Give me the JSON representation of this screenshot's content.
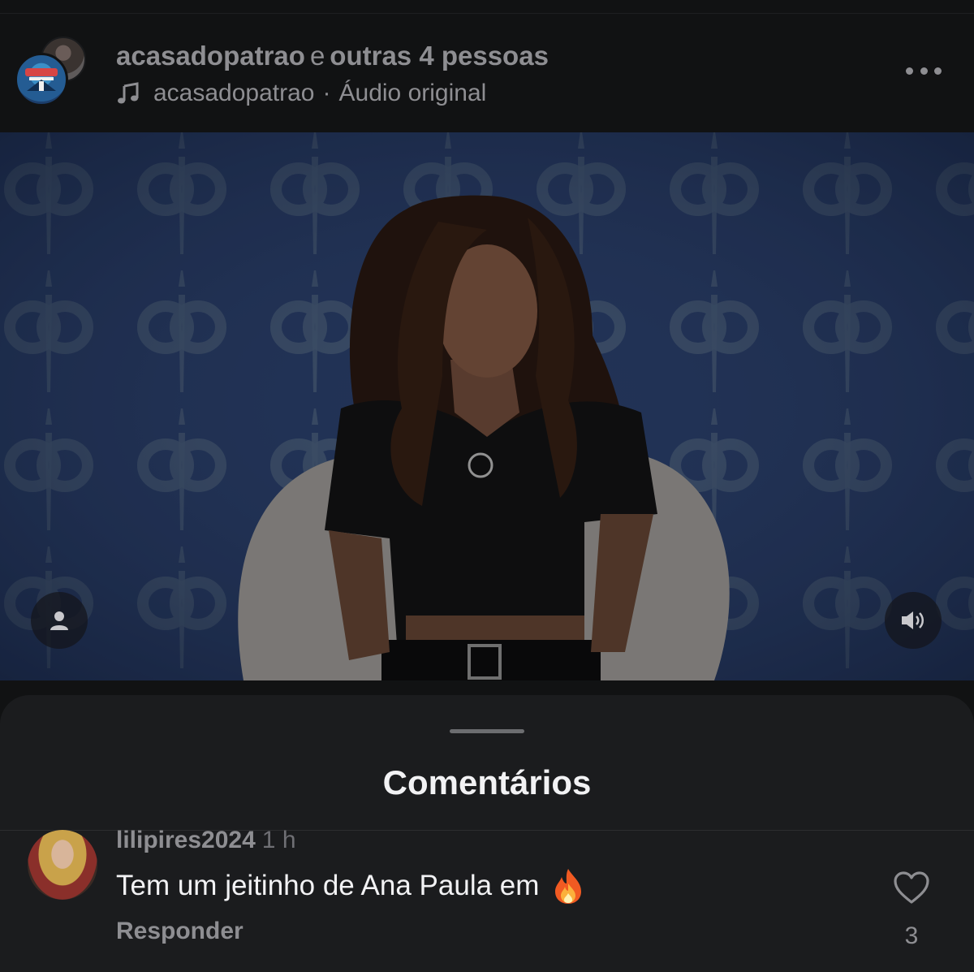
{
  "header": {
    "user": "acasadopatrao",
    "connector": "e",
    "others": "outras 4 pessoas",
    "audio_user": "acasadopatrao",
    "audio_separator": "·",
    "audio_label": "Áudio original",
    "icons": {
      "music": "music-note-icon",
      "more": "more-options-icon"
    }
  },
  "video": {
    "icons": {
      "user": "person-icon",
      "sound": "speaker-icon"
    },
    "colors": {
      "background": "#2a3e6a",
      "logo": "#58708e"
    }
  },
  "comments": {
    "title": "Comentários",
    "items": [
      {
        "username": "lilipires2024",
        "time": "1 h",
        "text": "Tem um jeitinho de Ana Paula em",
        "emoji_icon": "fire-icon",
        "reply_label": "Responder",
        "likes": "3"
      }
    ]
  }
}
